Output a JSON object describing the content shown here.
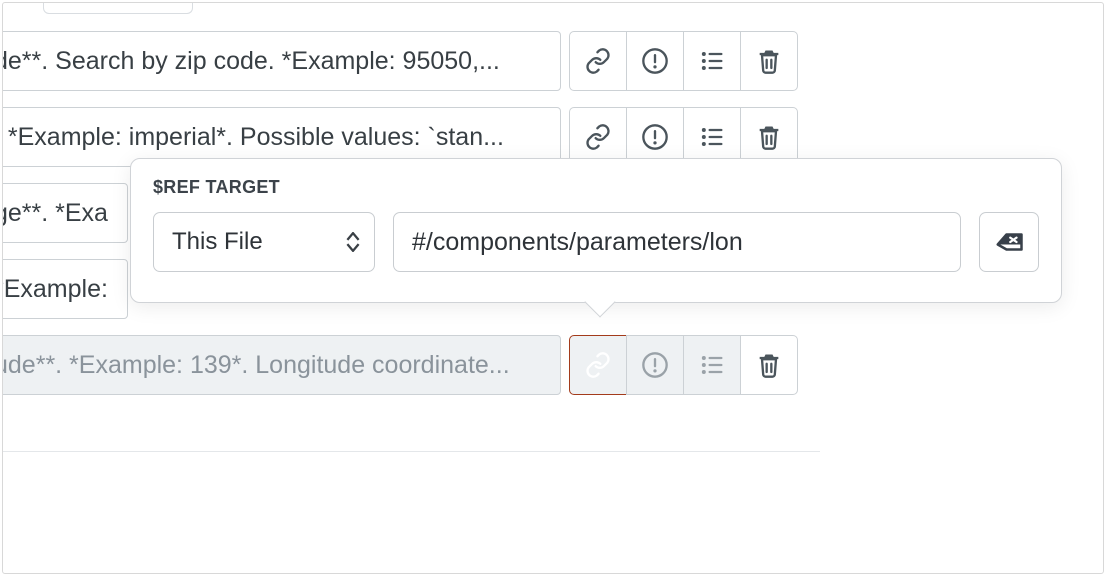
{
  "rows": [
    {
      "text": "de**. Search by zip code. *Example: 95050,..."
    },
    {
      "text": ". *Example: imperial*. Possible values: `stan..."
    },
    {
      "text": "ge**. *Exa"
    },
    {
      "text": "*Example:"
    },
    {
      "text": "ude**. *Example: 139*. Longitude coordinate..."
    }
  ],
  "popover": {
    "label": "$REF TARGET",
    "select_value": "This File",
    "input_value": "#/components/parameters/lon"
  }
}
